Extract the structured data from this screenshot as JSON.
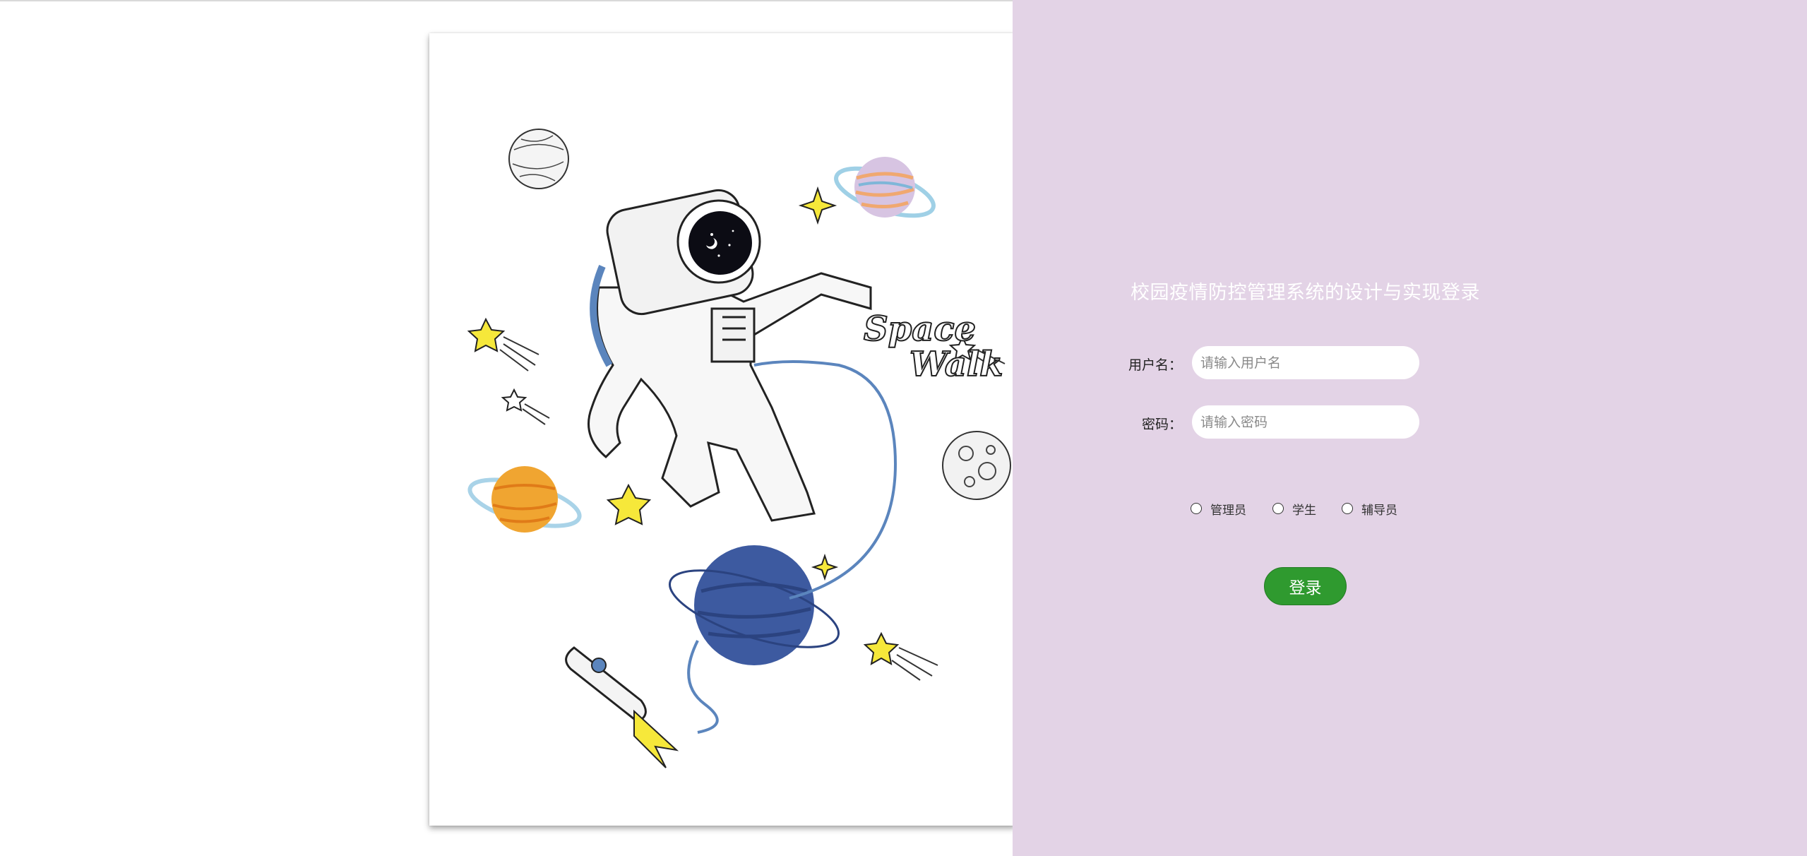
{
  "poster": {
    "art_text_line1": "Space",
    "art_text_line2": "Walk"
  },
  "login": {
    "title": "校园疫情防控管理系统的设计与实现登录",
    "username_label": "用户名：",
    "username_placeholder": "请输入用户名",
    "password_label": "密码：",
    "password_placeholder": "请输入密码",
    "roles": [
      "管理员",
      "学生",
      "辅导员"
    ],
    "submit_label": "登录"
  },
  "colors": {
    "panel_background": "#e3d3e6",
    "button_green": "#2f9a2f"
  }
}
